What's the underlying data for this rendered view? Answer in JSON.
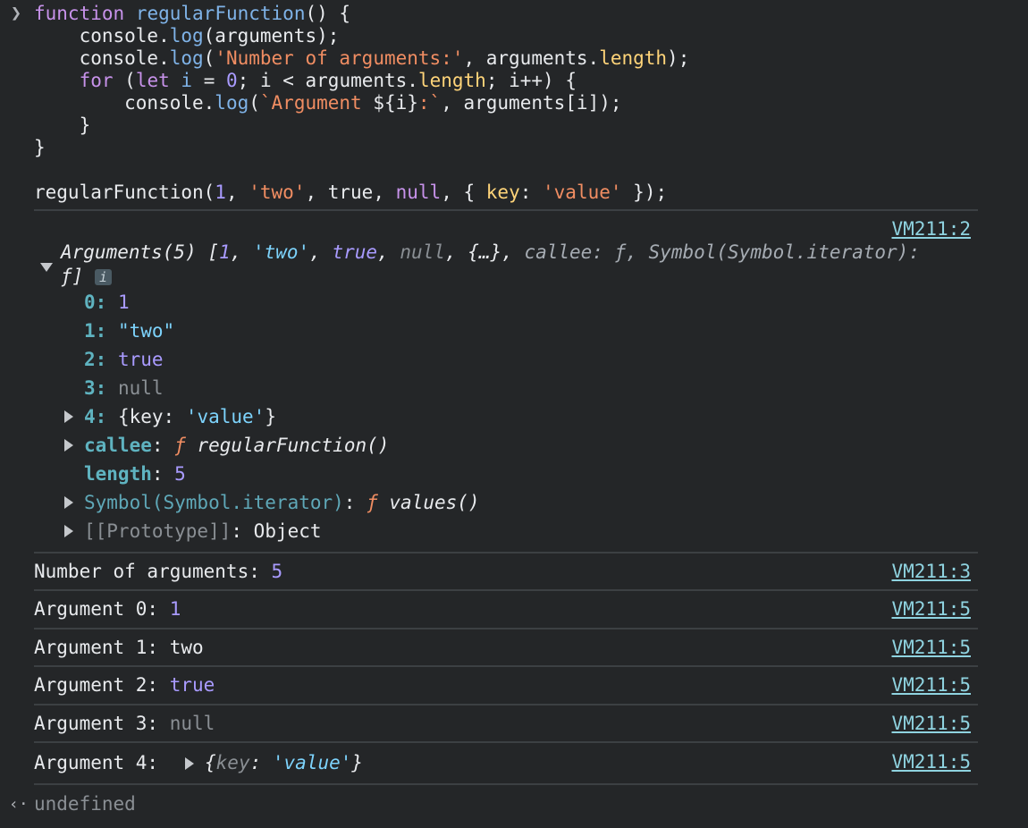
{
  "input": {
    "code_lines": [
      "function regularFunction() {",
      "    console.log(arguments);",
      "    console.log('Number of arguments:', arguments.length);",
      "    for (let i = 0; i < arguments.length; i++) {",
      "        console.log(`Argument ${i}:`, arguments[i]);",
      "    }",
      "}",
      "",
      "regularFunction(1, 'two', true, null, { key: 'value' });"
    ]
  },
  "output": {
    "arguments_log": {
      "source": "VM211:2",
      "summary_line1": "Arguments(5) [1, 'two', true, null, {…}, callee: ƒ, Symbol(Symbol.iterator):",
      "summary_line2": "ƒ]",
      "info_badge": "i",
      "entries": {
        "k0": "0",
        "v0": "1",
        "k1": "1",
        "v1": "\"two\"",
        "k2": "2",
        "v2": "true",
        "k3": "3",
        "v3": "null",
        "k4": "4",
        "v4_open": "{key: ",
        "v4_val": "'value'",
        "v4_close": "}",
        "callee_key": "callee",
        "callee_f": "ƒ",
        "callee_val": "regularFunction()",
        "length_key": "length",
        "length_val": "5",
        "symbol_key": "Symbol(Symbol.iterator)",
        "symbol_f": "ƒ",
        "symbol_val": "values()",
        "proto_key": "[[Prototype]]",
        "proto_val": "Object"
      }
    },
    "rows": [
      {
        "label": "Number of arguments: ",
        "value": "5",
        "source": "VM211:3"
      },
      {
        "label": "Argument 0: ",
        "value": "1",
        "source": "VM211:5"
      },
      {
        "label": "Argument 1: ",
        "value": "two",
        "source": "VM211:5"
      },
      {
        "label": "Argument 2: ",
        "value": "true",
        "source": "VM211:5"
      },
      {
        "label": "Argument 3: ",
        "value": "null",
        "source": "VM211:5"
      },
      {
        "label": "Argument 4: ",
        "value_open": "{",
        "value_key": "key",
        "value_colon": ": ",
        "value_val": "'value'",
        "value_close": "}",
        "source": "VM211:5"
      }
    ],
    "result": "undefined"
  },
  "colors": {
    "background": "#242628",
    "keyword": "#c792ea",
    "function_name": "#7fb3e8",
    "string": "#f08d62",
    "property": "#ffd479",
    "number": "#a99bff",
    "null": "#8a8f94",
    "link": "#8fd3e0"
  },
  "icons": {
    "prompt": "chevron-right-icon",
    "result": "return-arrow-icon",
    "expand": "triangle-right-icon",
    "collapse": "triangle-down-icon"
  }
}
